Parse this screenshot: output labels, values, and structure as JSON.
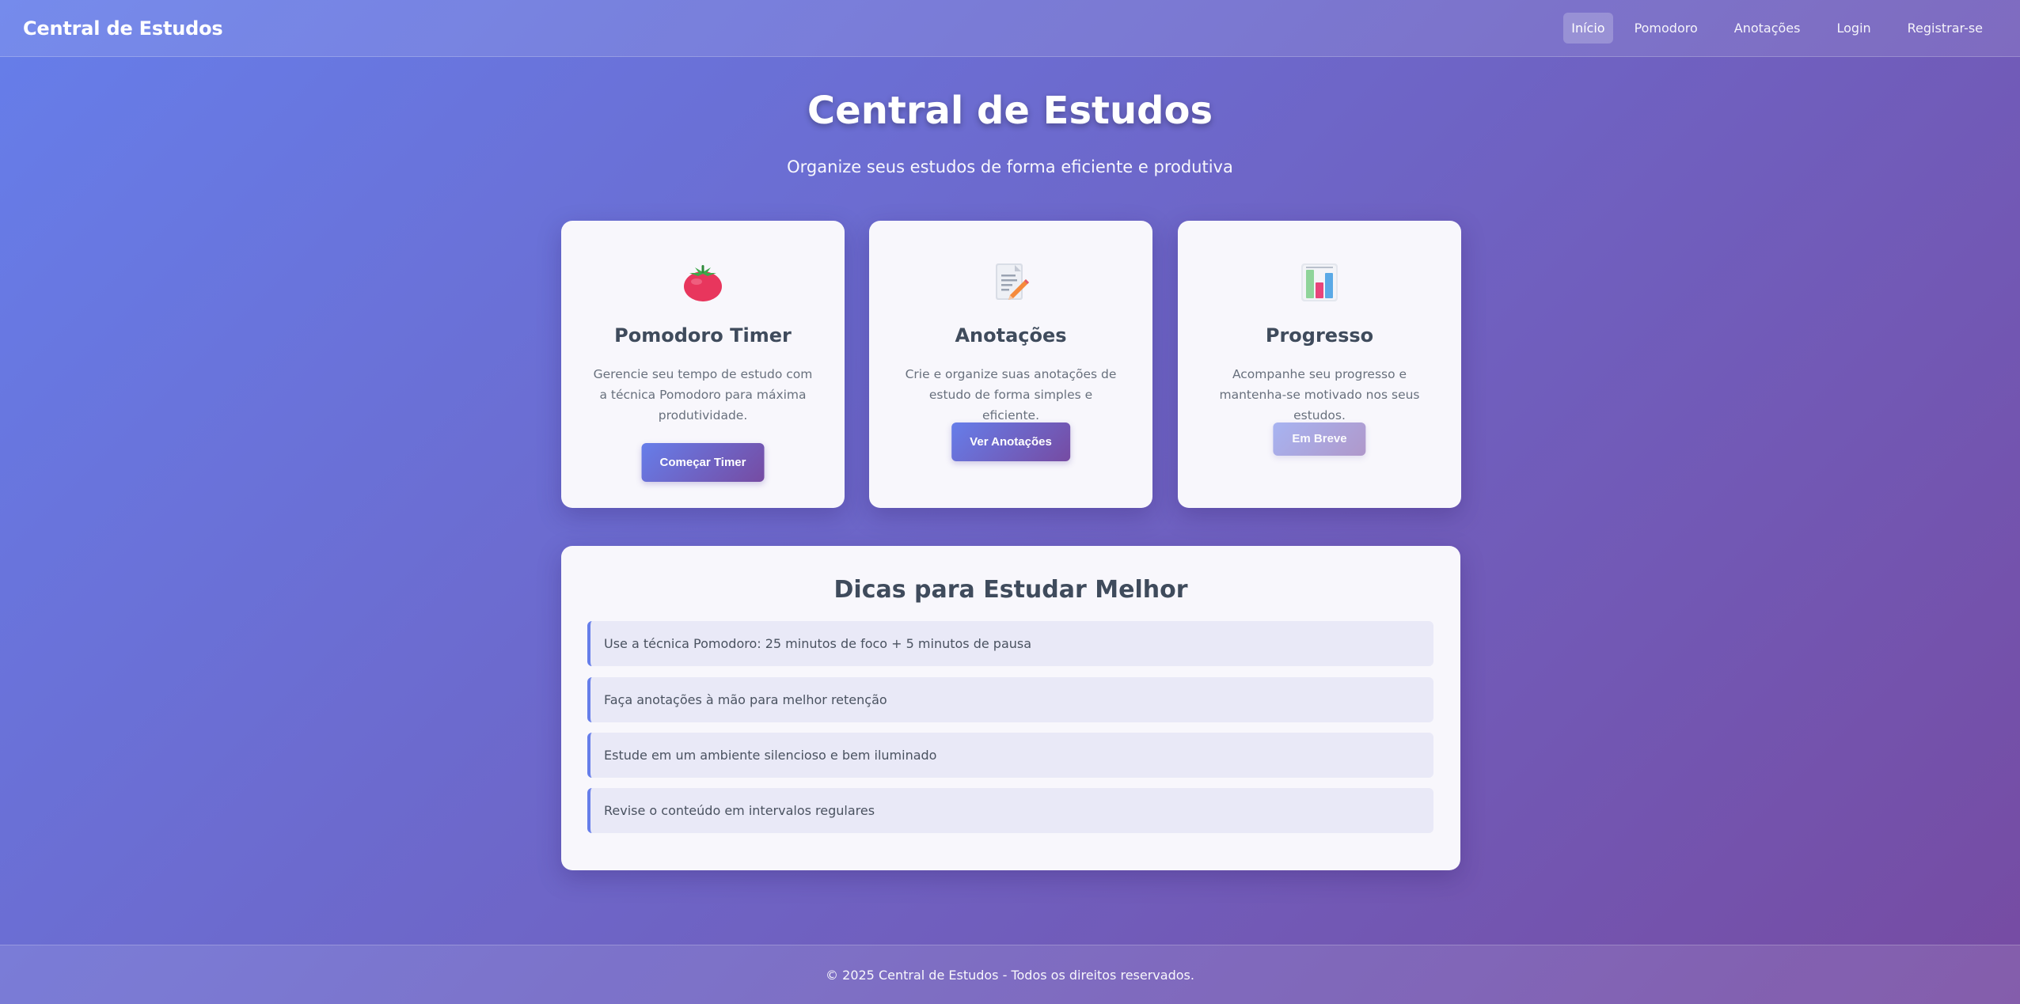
{
  "navbar": {
    "brand": "Central de Estudos",
    "links": [
      {
        "label": "Início",
        "active": true
      },
      {
        "label": "Pomodoro"
      },
      {
        "label": "Anotações"
      },
      {
        "label": "Login"
      },
      {
        "label": "Registrar-se"
      }
    ]
  },
  "hero": {
    "title": "Central de Estudos",
    "subtitle": "Organize seus estudos de forma eficiente e produtiva"
  },
  "cards": [
    {
      "icon": "tomato-icon",
      "title": "Pomodoro Timer",
      "description": "Gerencie seu tempo de estudo com a técnica Pomodoro para máxima produtividade.",
      "button": "Começar Timer"
    },
    {
      "icon": "memo-icon",
      "title": "Anotações",
      "description": "Crie e organize suas anotações de estudo de forma simples e eficiente.",
      "button": "Ver Anotações"
    },
    {
      "icon": "bar-chart-icon",
      "title": "Progresso",
      "description": "Acompanhe seu progresso e mantenha-se motivado nos seus estudos.",
      "button": "Em Breve",
      "disabled": true
    }
  ],
  "tips": {
    "title": "Dicas para Estudar Melhor",
    "items": [
      "Use a técnica Pomodoro: 25 minutos de foco + 5 minutos de pausa",
      "Faça anotações à mão para melhor retenção",
      "Estude em um ambiente silencioso e bem iluminado",
      "Revise o conteúdo em intervalos regulares"
    ]
  },
  "footer": {
    "text": "© 2025 Central de Estudos - Todos os direitos reservados."
  },
  "colors": {
    "gradient_start": "#667eea",
    "gradient_end": "#764ba2",
    "card_bg": "#f8f7fc",
    "tip_bg": "#e9e9f7"
  }
}
